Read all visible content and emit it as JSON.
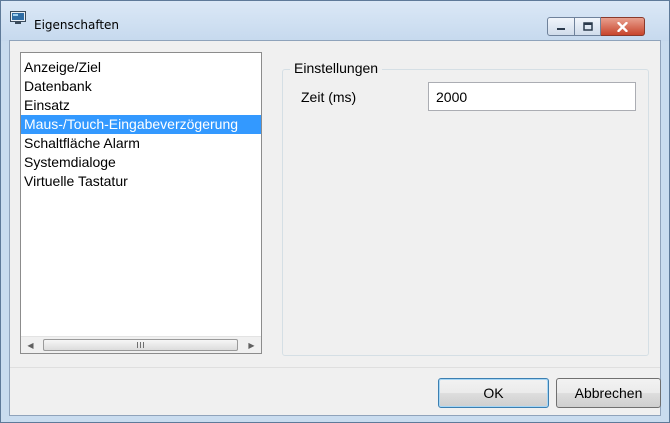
{
  "window": {
    "title": "Eigenschaften",
    "colors": {
      "titlebar": "#c6d9ee",
      "close_button": "#c8452c",
      "selection": "#3399ff"
    }
  },
  "title_buttons": {
    "minimize_icon": "minimize-icon",
    "maximize_icon": "maximize-icon",
    "close_icon": "close-icon"
  },
  "categories": {
    "items": [
      "Anzeige/Ziel",
      "Datenbank",
      "Einsatz",
      "Maus-/Touch-Eingabeverzögerung",
      "Schaltfläche Alarm",
      "Systemdialoge",
      "Virtuelle Tastatur"
    ],
    "selected_index": 3
  },
  "settings": {
    "group_title": "Einstellungen",
    "time_label": "Zeit (ms)",
    "time_value": "2000"
  },
  "buttons": {
    "ok": "OK",
    "cancel": "Abbrechen"
  }
}
